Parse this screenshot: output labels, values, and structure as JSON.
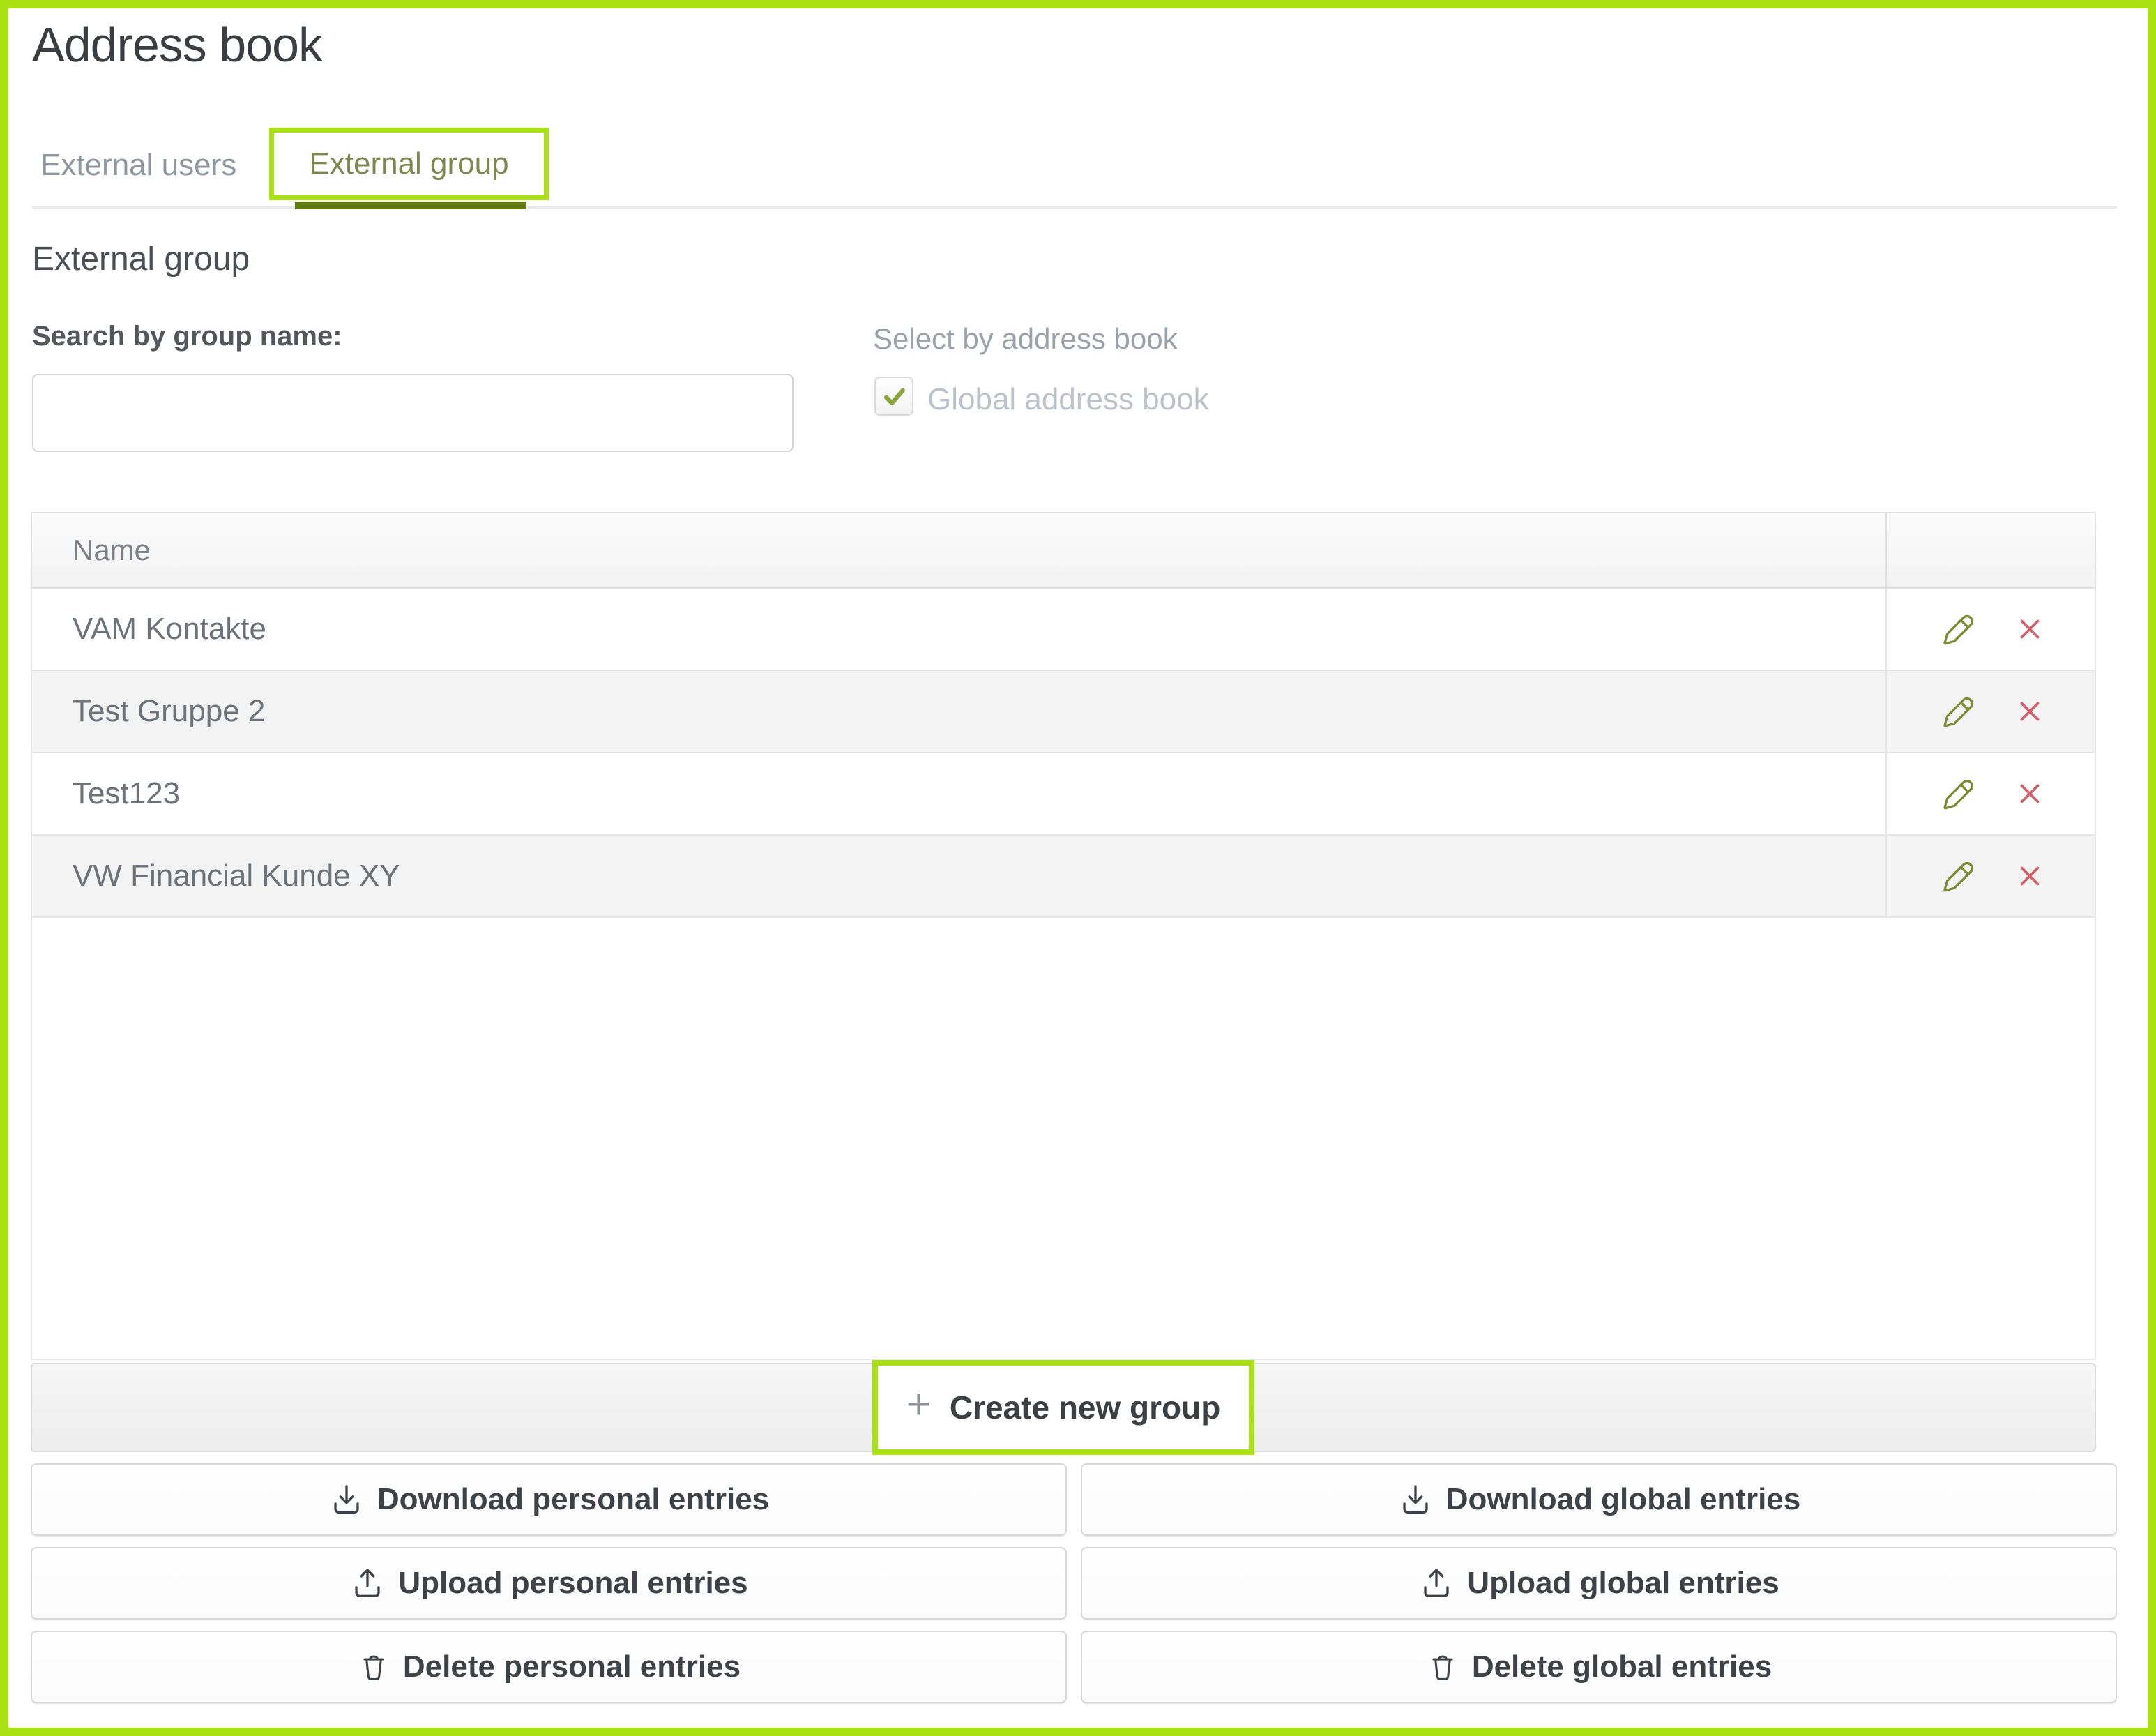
{
  "window": {
    "title": "Address book"
  },
  "tabs": [
    {
      "label": "External users",
      "active": false
    },
    {
      "label": "External group",
      "active": true
    }
  ],
  "section": {
    "heading": "External group"
  },
  "search": {
    "label": "Search by group name:",
    "value": "",
    "placeholder": ""
  },
  "address_book_filter": {
    "label": "Select by address book",
    "checkbox": {
      "label": "Global address book",
      "checked": true,
      "disabled": true,
      "icon": "check-icon"
    }
  },
  "table": {
    "columns": [
      {
        "label": "Name"
      },
      {
        "label": ""
      }
    ],
    "rows": [
      {
        "name": "VAM Kontakte"
      },
      {
        "name": "Test Gruppe 2"
      },
      {
        "name": "Test123"
      },
      {
        "name": "VW Financial Kunde XY"
      }
    ],
    "row_actions": [
      {
        "action": "edit",
        "icon": "pencil-icon"
      },
      {
        "action": "delete",
        "icon": "x-icon"
      }
    ]
  },
  "create_group": {
    "label": "Create new group",
    "icon": "plus-icon",
    "icon_glyph": "+"
  },
  "actions": {
    "buttons": [
      {
        "label": "Download personal entries",
        "icon": "download-icon"
      },
      {
        "label": "Download global entries",
        "icon": "download-icon"
      },
      {
        "label": "Upload personal entries",
        "icon": "upload-icon"
      },
      {
        "label": "Upload global entries",
        "icon": "upload-icon"
      },
      {
        "label": "Delete personal entries",
        "icon": "trash-icon"
      },
      {
        "label": "Delete global entries",
        "icon": "trash-icon"
      }
    ]
  },
  "annotations": {
    "highlight_color": "#a9e112",
    "highlighted_elements": [
      "screenshot-frame",
      "external-group-tab",
      "create-new-group-button"
    ]
  },
  "colors": {
    "accent_lime": "#a9e112",
    "tab_underline": "#5f7a12",
    "pencil_icon": "#7d8a33",
    "delete_icon": "#d2606a",
    "checkbox_check": "#8aa53f"
  }
}
